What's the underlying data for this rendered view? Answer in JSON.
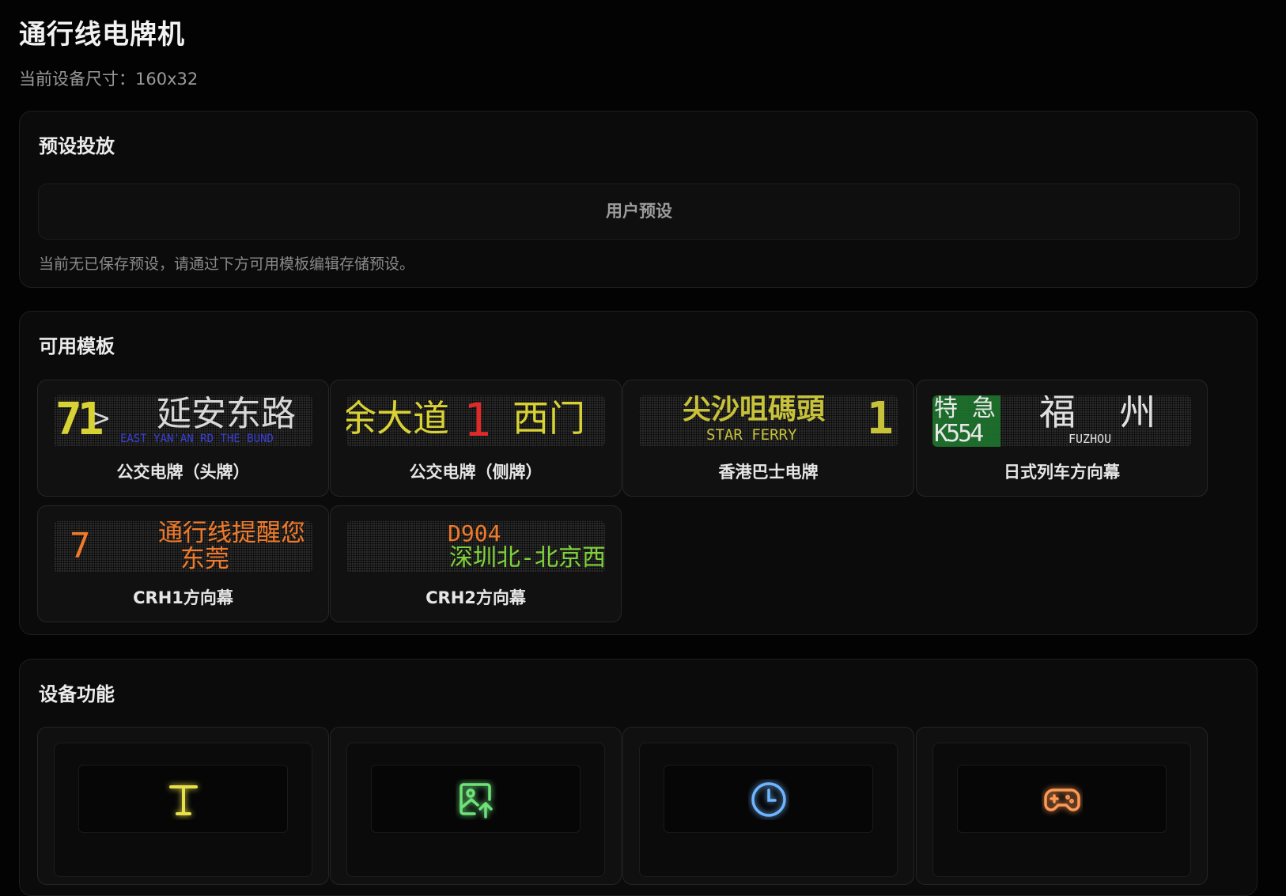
{
  "app": {
    "title": "通行线电牌机",
    "device_size_text": "当前设备尺寸：160x32"
  },
  "presets": {
    "title": "预设投放",
    "tab_label": "用户预设",
    "empty_hint": "当前无已保存预设，请通过下方可用模板编辑存储预设。"
  },
  "templates": {
    "title": "可用模板",
    "items": [
      {
        "label": "公交电牌（头牌）",
        "display": {
          "route": "71",
          "arrow": ">",
          "main": "延安东路",
          "sub": "EAST YAN'AN RD THE BUND"
        }
      },
      {
        "label": "公交电牌（侧牌）",
        "display": {
          "left": "余大道",
          "number": "1",
          "right": "西门"
        }
      },
      {
        "label": "香港巴士电牌",
        "display": {
          "main": "尖沙咀碼頭",
          "sub": "STAR FERRY",
          "number": "1"
        }
      },
      {
        "label": "日式列车方向幕",
        "display": {
          "type": "特 急",
          "train": "K554",
          "main": "福  州",
          "sub": "FUZHOU"
        }
      },
      {
        "label": "CRH1方向幕",
        "display": {
          "number": "7",
          "line1": "通行线提醒您",
          "line2": "东莞"
        }
      },
      {
        "label": "CRH2方向幕",
        "display": {
          "train": "D904",
          "route": "深圳北-北京西"
        }
      }
    ]
  },
  "features": {
    "title": "设备功能",
    "items": [
      {
        "icon": "text-icon",
        "color": "#e8e04a"
      },
      {
        "icon": "image-upload-icon",
        "color": "#6ee37a"
      },
      {
        "icon": "clock-icon",
        "color": "#6fb6ff"
      },
      {
        "icon": "gamepad-icon",
        "color": "#ff9a55"
      }
    ]
  },
  "colors": {
    "led_yellow": "#d9d234",
    "led_blue": "#3a3fd6",
    "led_red": "#e02a2a",
    "led_white": "#d8d8d8",
    "led_orange": "#f07a2a",
    "led_green": "#7ed23a",
    "jp_green": "#1f7a2f"
  }
}
